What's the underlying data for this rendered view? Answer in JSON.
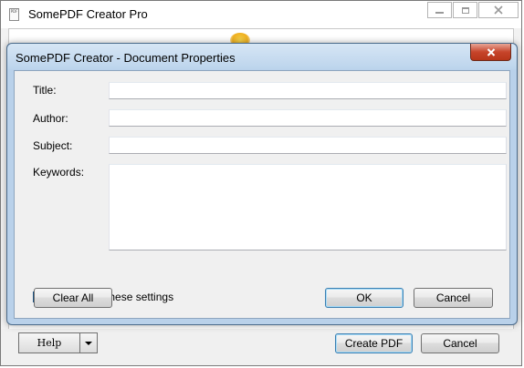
{
  "main_window": {
    "title": "SomePDF Creator Pro",
    "icon_text": "PDF",
    "buttons": {
      "help_label": "Help",
      "create_pdf_label": "Create PDF",
      "cancel_label": "Cancel"
    }
  },
  "dialog": {
    "title": "SomePDF Creator - Document Properties",
    "close_label": "x",
    "fields": {
      "title_label": "Title:",
      "title_value": "",
      "author_label": "Author:",
      "author_value": "",
      "subject_label": "Subject:",
      "subject_value": "",
      "keywords_label": "Keywords:",
      "keywords_value": ""
    },
    "always_use": {
      "label": "Always use these settings",
      "checked": true,
      "check_glyph": "✓"
    },
    "buttons": {
      "clear_all_label": "Clear All",
      "ok_label": "OK",
      "cancel_label": "Cancel"
    }
  },
  "colors": {
    "dialog_frame": "#b9d1ea",
    "close_button": "#c7452b",
    "default_button_border": "#3c7fb1"
  }
}
